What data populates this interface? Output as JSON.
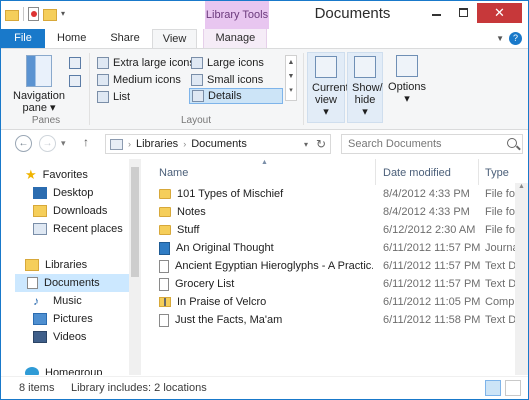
{
  "window": {
    "title": "Documents",
    "context_tab": "Library Tools"
  },
  "ribbon_tabs": {
    "file": "File",
    "home": "Home",
    "share": "Share",
    "view": "View",
    "manage": "Manage",
    "help": "?"
  },
  "ribbon": {
    "panes_group": "Panes",
    "navigation_pane_line1": "Navigation",
    "navigation_pane_line2": "pane",
    "layout_group": "Layout",
    "layout_items": [
      "Extra large icons",
      "Large icons",
      "Medium icons",
      "Small icons",
      "List",
      "Details"
    ],
    "current_view_line1": "Current",
    "current_view_line2": "view",
    "show_hide_line1": "Show/",
    "show_hide_line2": "hide",
    "options": "Options"
  },
  "address": {
    "crumbs": [
      "Libraries",
      "Documents"
    ],
    "search_placeholder": "Search Documents"
  },
  "nav": {
    "favorites": "Favorites",
    "desktop": "Desktop",
    "downloads": "Downloads",
    "recent_places": "Recent places",
    "libraries": "Libraries",
    "documents": "Documents",
    "music": "Music",
    "pictures": "Pictures",
    "videos": "Videos",
    "homegroup": "Homegroup"
  },
  "columns": {
    "name": "Name",
    "date_modified": "Date modified",
    "type": "Type"
  },
  "files": [
    {
      "name": "101 Types of Mischief",
      "date": "8/4/2012 4:33 PM",
      "type": "File folder",
      "icon": "folder"
    },
    {
      "name": "Notes",
      "date": "8/4/2012 4:33 PM",
      "type": "File folder",
      "icon": "folder"
    },
    {
      "name": "Stuff",
      "date": "6/12/2012 2:30 AM",
      "type": "File folder",
      "icon": "folder"
    },
    {
      "name": "An Original Thought",
      "date": "6/11/2012 11:57 PM",
      "type": "Journal Doc",
      "icon": "journal"
    },
    {
      "name": "Ancient Egyptian Hieroglyphs - A Practic...",
      "date": "6/11/2012 11:57 PM",
      "type": "Text Doc",
      "icon": "doc"
    },
    {
      "name": "Grocery List",
      "date": "6/11/2012 11:57 PM",
      "type": "Text Doc",
      "icon": "doc"
    },
    {
      "name": "In Praise of Velcro",
      "date": "6/11/2012 11:05 PM",
      "type": "Compressed",
      "icon": "zip"
    },
    {
      "name": "Just the Facts, Ma'am",
      "date": "6/11/2012 11:58 PM",
      "type": "Text Doc",
      "icon": "doc"
    }
  ],
  "status": {
    "count": "8 items",
    "library": "Library includes: 2 locations"
  }
}
